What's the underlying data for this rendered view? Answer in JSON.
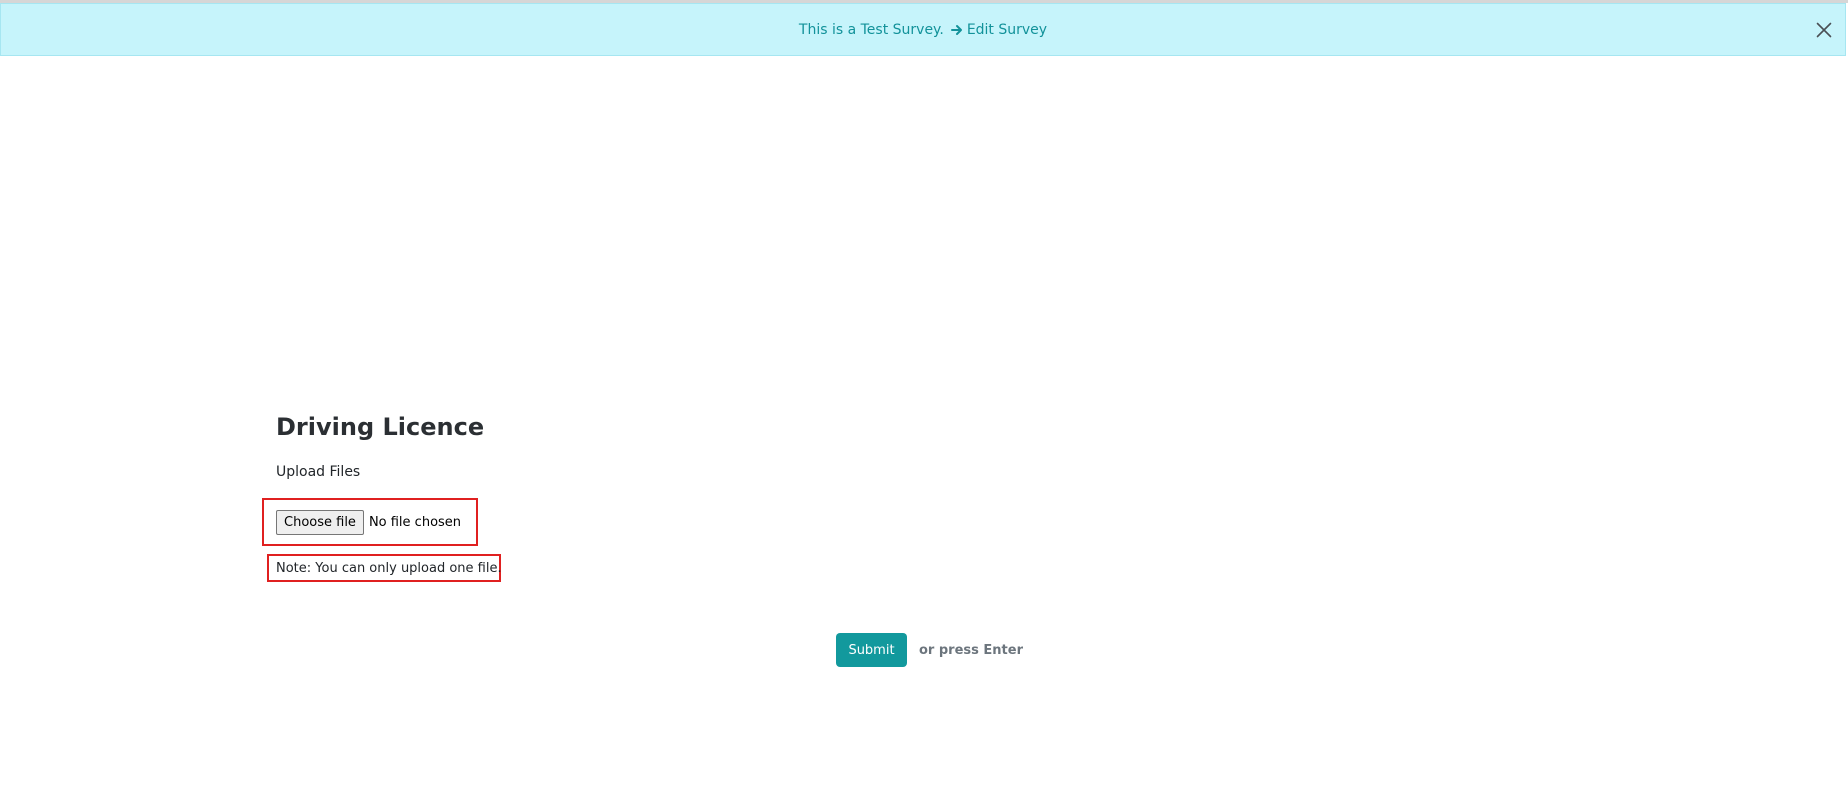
{
  "banner": {
    "text": "This is a Test Survey.",
    "edit_link": "Edit Survey",
    "background": "#c6f4fb",
    "text_color": "#12929a",
    "icons": {
      "link": "arrow-right-icon",
      "close": "close-icon"
    }
  },
  "question": {
    "title": "Driving Licence",
    "label": "Upload Files",
    "choose_button": "Choose file",
    "file_status": "No file chosen",
    "note": "Note: You can only upload one file."
  },
  "footer": {
    "submit_label": "Submit",
    "hint": "or press Enter",
    "accent": "#12999d"
  },
  "highlight_color": "#e02020"
}
